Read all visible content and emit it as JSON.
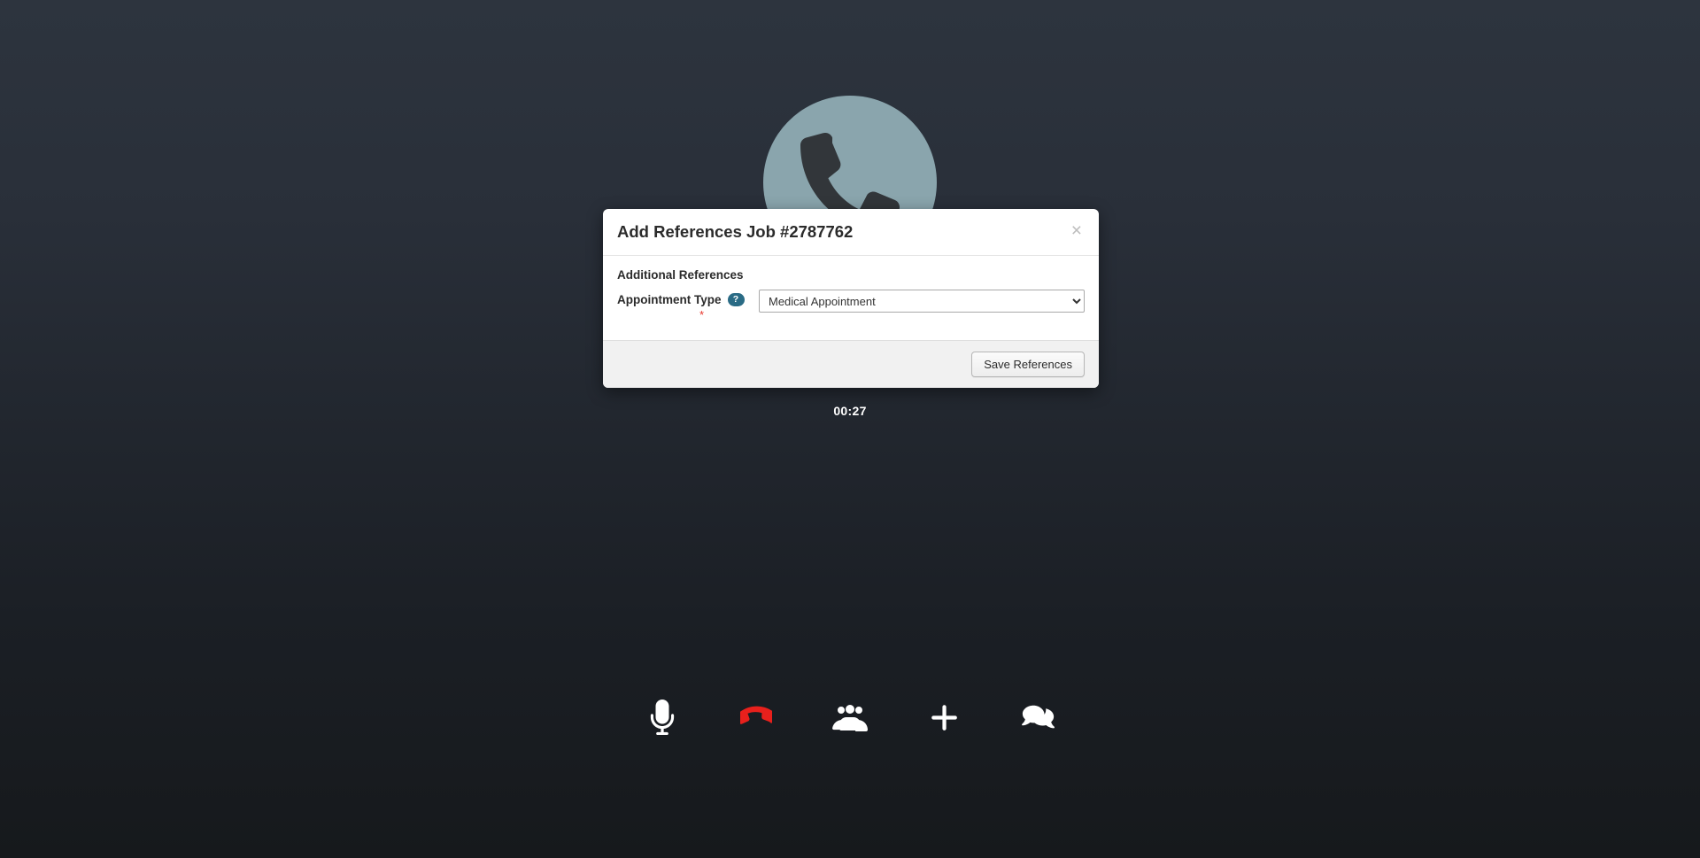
{
  "call": {
    "avatar_icon": "phone-handset-icon",
    "avatar_color": "#8aa5ad",
    "timer": "00:27",
    "background_top_color": "#2d343e",
    "background_bottom_color": "#16191c"
  },
  "modal": {
    "title": "Add References Job #2787762",
    "close_label": "×",
    "section_label": "Additional References",
    "field": {
      "label": "Appointment Type",
      "help_badge": "?",
      "required_marker": "*",
      "selected_value": "Medical Appointment",
      "options": [
        "Medical Appointment"
      ]
    },
    "save_label": "Save References",
    "accent_help_color": "#2a6b85",
    "required_color": "#e8342a"
  },
  "toolbar": {
    "items": [
      {
        "name": "microphone-icon",
        "label": "Mute",
        "color": "#ffffff"
      },
      {
        "name": "hangup-phone-icon",
        "label": "Hang Up",
        "color": "#e8201c"
      },
      {
        "name": "participants-icon",
        "label": "Participants",
        "color": "#ffffff"
      },
      {
        "name": "add-icon",
        "label": "Add",
        "color": "#ffffff"
      },
      {
        "name": "chat-icon",
        "label": "Chat",
        "color": "#ffffff"
      }
    ]
  }
}
